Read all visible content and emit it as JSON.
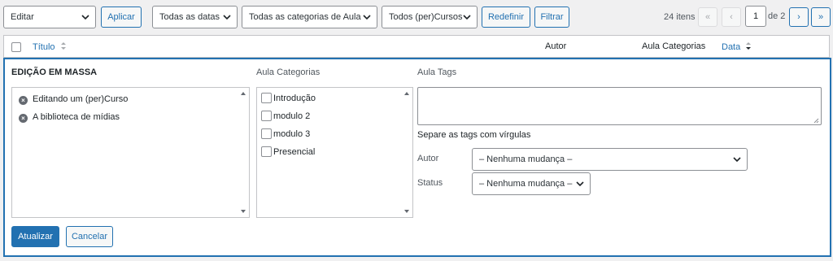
{
  "toolbar": {
    "bulk_action": "Editar",
    "apply": "Aplicar",
    "dates_filter": "Todas as datas",
    "categories_filter": "Todas as categorias de Aula",
    "courses_filter": "Todos (per)Cursos",
    "reset": "Redefinir",
    "filter": "Filtrar"
  },
  "pagination": {
    "items": "24 itens",
    "first": "«",
    "prev": "‹",
    "current_page": "1",
    "of_total": "de 2",
    "next": "›",
    "last": "»"
  },
  "columns": {
    "title": "Título",
    "author": "Autor",
    "categories": "Aula Categorias",
    "date": "Data"
  },
  "bulk_edit": {
    "heading": "EDIÇÃO EM MASSA",
    "posts": [
      "Editando um (per)Curso",
      "A biblioteca de mídias"
    ],
    "categories_label": "Aula Categorias",
    "categories": [
      "Introdução",
      "modulo 2",
      "modulo 3",
      "Presencial"
    ],
    "tags_label": "Aula Tags",
    "tags_value": "",
    "tags_hint": "Separe as tags com vírgulas",
    "author_label": "Autor",
    "author_value": "– Nenhuma mudança –",
    "status_label": "Status",
    "status_value": "– Nenhuma mudança –",
    "update": "Atualizar",
    "cancel": "Cancelar"
  },
  "colors": {
    "primary": "#2271b1",
    "border": "#c3c4c7",
    "background": "#f0f0f1"
  }
}
